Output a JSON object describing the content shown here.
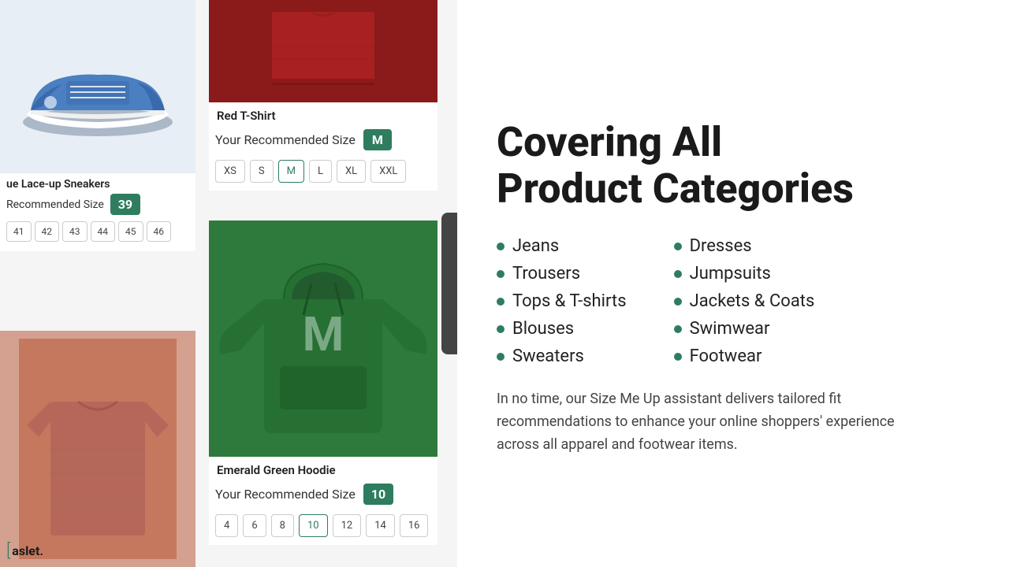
{
  "left": {
    "red_shirt": {
      "name": "Red T-Shirt",
      "recommended_label": "Your Recommended Size",
      "recommended_size": "M",
      "sizes": [
        "XS",
        "S",
        "M",
        "L",
        "XL",
        "XXL"
      ],
      "active_size": "M"
    },
    "sneaker": {
      "name": "ue Lace-up Sneakers",
      "recommended_label": "Recommended Size",
      "recommended_size": "39",
      "sizes": [
        "41",
        "42",
        "43",
        "44",
        "45",
        "46"
      ]
    },
    "green_hoodie": {
      "name": "Emerald Green Hoodie",
      "recommended_label": "Your Recommended Size",
      "recommended_size": "10",
      "sizes": [
        "4",
        "6",
        "8",
        "10",
        "12",
        "14",
        "16"
      ]
    },
    "logo": {
      "bracket": "[",
      "text": "aslet."
    }
  },
  "right": {
    "title_line1": "Covering All",
    "title_line2": "Product Categories",
    "categories_left": [
      "Jeans",
      "Trousers",
      "Tops & T-shirts",
      "Blouses",
      "Sweaters"
    ],
    "categories_right": [
      "Dresses",
      "Jumpsuits",
      "Jackets & Coats",
      "Swimwear",
      "Footwear"
    ],
    "description": "In no time, our Size Me Up assistant delivers tailored fit recommendations to enhance your online shoppers' experience across all apparel and footwear items."
  }
}
